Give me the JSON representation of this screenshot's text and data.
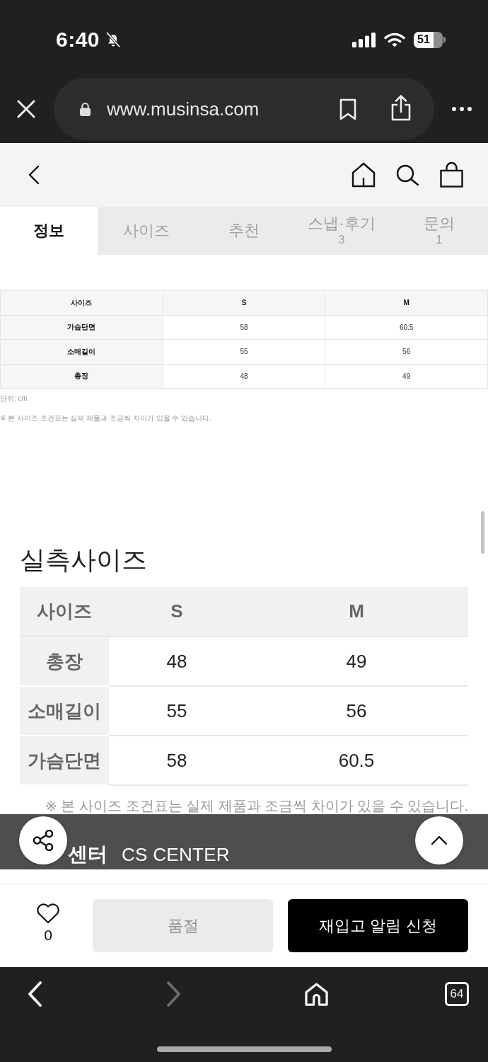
{
  "status_bar": {
    "time": "6:40",
    "battery": "51"
  },
  "browser": {
    "url": "www.musinsa.com"
  },
  "tabs": [
    {
      "label": "정보",
      "selected": true
    },
    {
      "label": "사이즈",
      "selected": false
    },
    {
      "label": "추천",
      "selected": false
    },
    {
      "label": "스냅·후기",
      "count": "3",
      "selected": false
    },
    {
      "label": "문의",
      "count": "1",
      "selected": false
    }
  ],
  "size_guide": {
    "columns": [
      "사이즈",
      "S",
      "M"
    ],
    "rows": [
      [
        "가슴단면",
        "58",
        "60.5"
      ],
      [
        "소매길이",
        "55",
        "56"
      ],
      [
        "총장",
        "48",
        "49"
      ]
    ],
    "unit": "단위: cm",
    "note": "※ 본 사이즈 조건표는 실제 제품과 조금씩 차이가 있을 수 있습니다."
  },
  "measured_size": {
    "title": "실측사이즈",
    "columns": [
      "사이즈",
      "S",
      "M"
    ],
    "rows": [
      [
        "총장",
        "48",
        "49"
      ],
      [
        "소매길이",
        "55",
        "56"
      ],
      [
        "가슴단면",
        "58",
        "60.5"
      ]
    ],
    "note": "※ 본 사이즈 조건표는 실제 제품과 조금씩 차이가 있을 수 있습니다."
  },
  "cs_center": {
    "title": "센터",
    "subtitle": "CS CENTER"
  },
  "purchase_bar": {
    "likes": "0",
    "liked": false,
    "sold_out": {
      "label": "품절",
      "disabled": true
    },
    "restock": {
      "label": "재입고 알림 신청"
    }
  },
  "bottom_toolbar": {
    "forward": {
      "disabled": true
    },
    "tab_count": "64"
  }
}
